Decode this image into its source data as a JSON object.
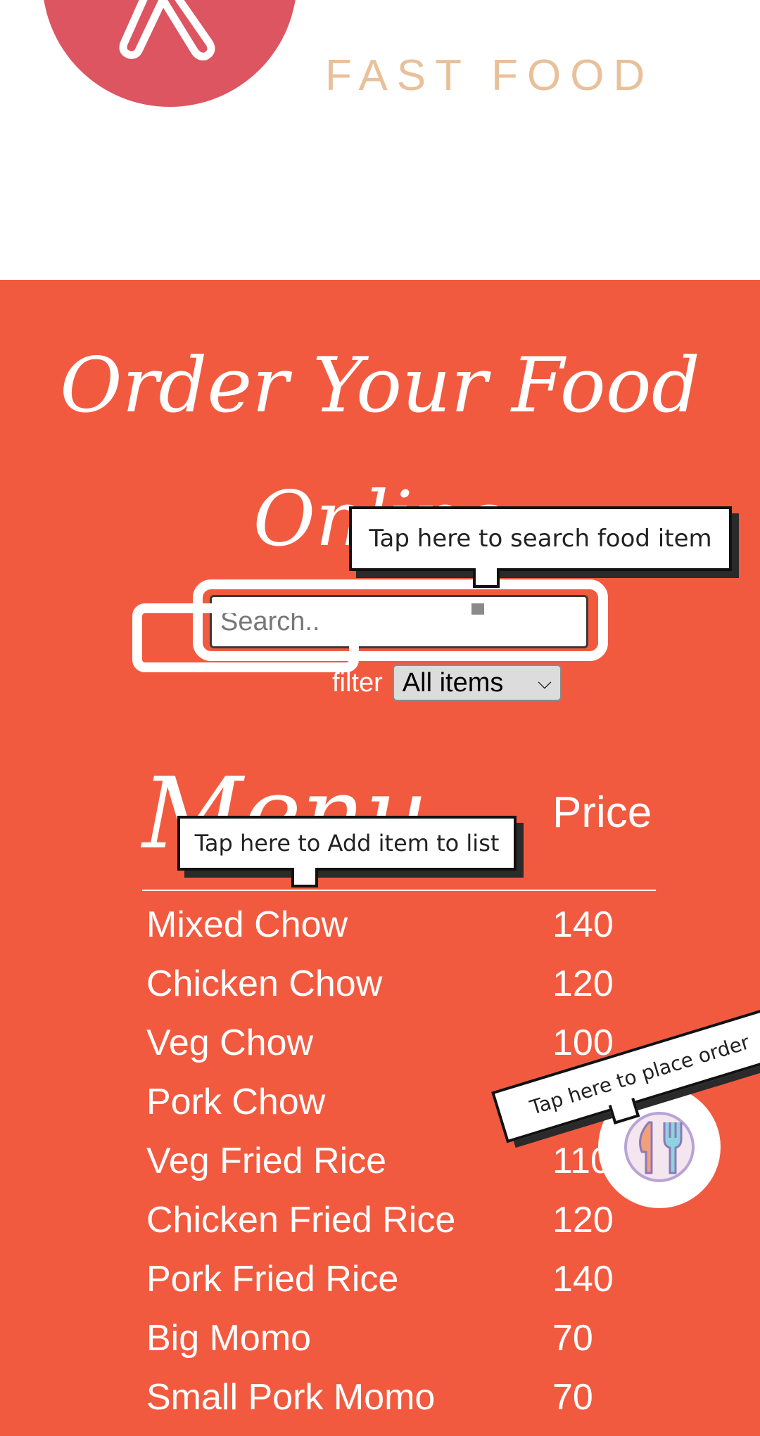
{
  "header": {
    "brand_subtitle": "FAST FOOD",
    "logo_icon": "fork-knife-logo-icon"
  },
  "main": {
    "title": "Order Your Food Online",
    "search": {
      "placeholder": "Search..",
      "value": ""
    },
    "filter": {
      "label": "filter",
      "selected": "All items"
    },
    "menu": {
      "name_header": "Menu",
      "price_header": "Price",
      "items": [
        {
          "name": "Mixed Chow",
          "price": "140"
        },
        {
          "name": "Chicken Chow",
          "price": "120"
        },
        {
          "name": "Veg Chow",
          "price": "100"
        },
        {
          "name": "Pork Chow",
          "price": ""
        },
        {
          "name": "Veg Fried Rice",
          "price": "110"
        },
        {
          "name": "Chicken Fried Rice",
          "price": "120"
        },
        {
          "name": "Pork Fried Rice",
          "price": "140"
        },
        {
          "name": "Big Momo",
          "price": "70"
        },
        {
          "name": "Small Pork Momo",
          "price": "70"
        }
      ]
    }
  },
  "tooltips": {
    "search": "Tap here to search food item",
    "add_item": "Tap here to Add item to list",
    "place_order": "Tap here to place order"
  },
  "order_button": {
    "icon": "knife-fork-icon"
  },
  "colors": {
    "primary": "#f25a40",
    "logo": "#dc5560",
    "subtitle": "#e8c09a"
  }
}
